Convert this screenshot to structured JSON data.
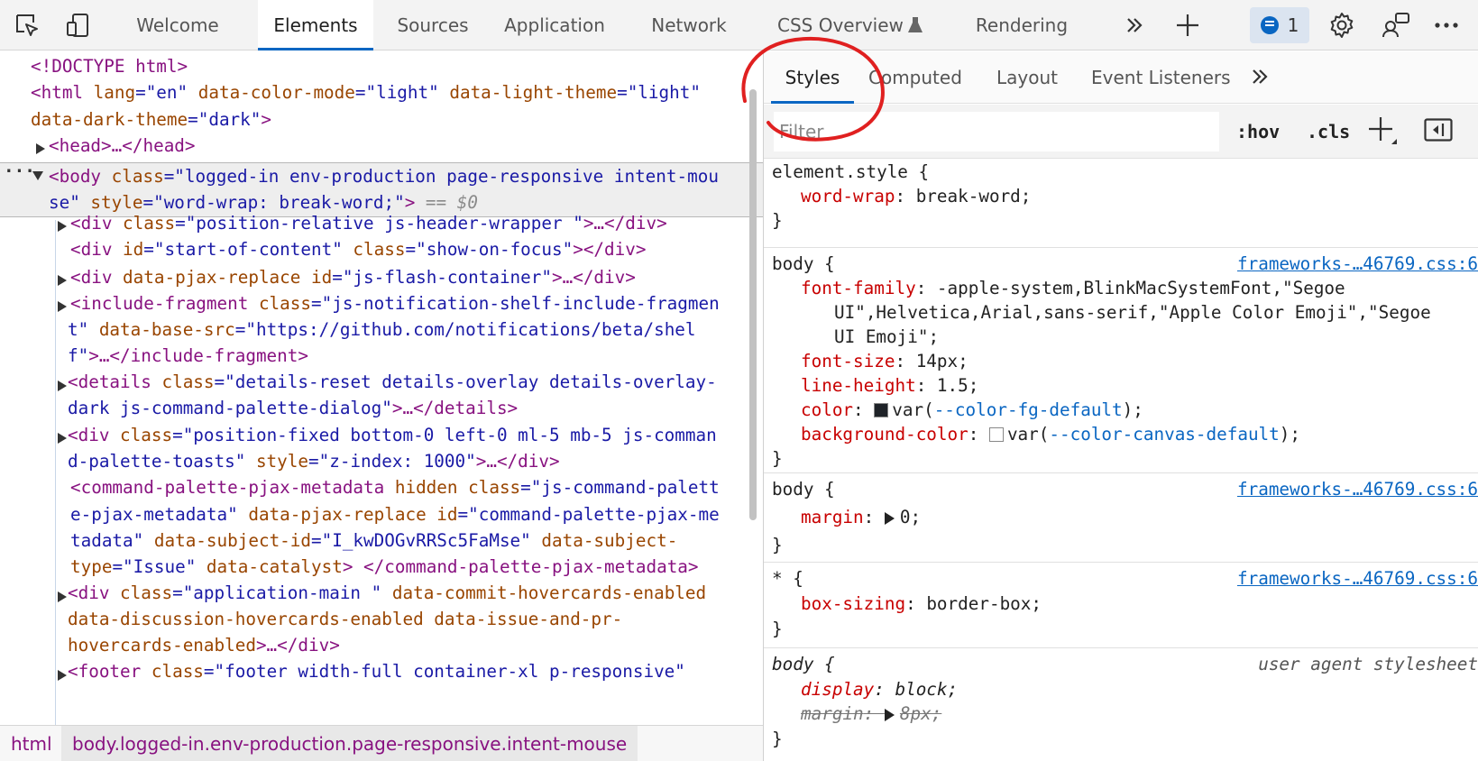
{
  "top_tabs": [
    "Welcome",
    "Elements",
    "Sources",
    "Application",
    "Network",
    "CSS Overview",
    "Rendering"
  ],
  "active_top_tab": "Elements",
  "issues_count": "1",
  "dom": {
    "l1": "<!DOCTYPE html>",
    "l2_tag": "<html",
    "l2_a1": " lang",
    "l2_v1": "=\"en\"",
    "l2_a2": " data-color-mode",
    "l2_v2": "=\"light\"",
    "l2_a3": " data-light-theme",
    "l2_v3": "=\"light\"",
    "l3_a": "data-dark-theme",
    "l3_v": "=\"dark\"",
    "l3_close": ">",
    "l4": "<head>…</head>",
    "l5_tag": "<body",
    "l5_a": " class",
    "l5_v": "=\"logged-in env-production page-responsive intent-mou",
    "l6_v": "se\"",
    "l6_a": " style",
    "l6_v2": "=\"word-wrap: break-word;\"",
    "l6_close": ">",
    "l6_eq": " == $0",
    "l7_tag": "<div",
    "l7_a": " class",
    "l7_v": "=\"position-relative js-header-wrapper \"",
    "l7_rest": ">…</div>",
    "l8_tag": "<div",
    "l8_a1": " id",
    "l8_v1": "=\"start-of-content\"",
    "l8_a2": " class",
    "l8_v2": "=\"show-on-focus\"",
    "l8_rest": "></div>",
    "l9_tag": "<div",
    "l9_a1": " data-pjax-replace",
    "l9_a2": " id",
    "l9_v2": "=\"js-flash-container\"",
    "l9_rest": ">…</div>",
    "l10_tag": "<include-fragment",
    "l10_a": " class",
    "l10_v": "=\"js-notification-shelf-include-fragmen",
    "l11_v": "t\"",
    "l11_a": " data-base-src",
    "l11_v2": "=\"https://github.com/notifications/beta/shel",
    "l12_v": "f\"",
    "l12_rest": ">…</include-fragment>",
    "l13_tag": "<details",
    "l13_a": " class",
    "l13_v": "=\"details-reset details-overlay details-overlay-",
    "l14_v": "dark js-command-palette-dialog\"",
    "l14_rest": ">…</details>",
    "l15_tag": "<div",
    "l15_a": " class",
    "l15_v": "=\"position-fixed bottom-0 left-0 ml-5 mb-5 js-comman",
    "l16_v": "d-palette-toasts\"",
    "l16_a": " style",
    "l16_v2": "=\"z-index: 1000\"",
    "l16_rest": ">…</div>",
    "l17_tag": "<command-palette-pjax-metadata",
    "l17_a1": " hidden",
    "l17_a2": " class",
    "l17_v2": "=\"js-command-palett",
    "l18_v": "e-pjax-metadata\"",
    "l18_a1": " data-pjax-replace",
    "l18_a2": " id",
    "l18_v2": "=\"command-palette-pjax-me",
    "l19_v": "tadata\"",
    "l19_a": " data-subject-id",
    "l19_v2": "=\"I_kwDOGvRRSc5FaMse\"",
    "l19_a2": " data-subject-",
    "l20_a": "type",
    "l20_v": "=\"Issue\"",
    "l20_a2": " data-catalyst",
    "l20_rest": "> </command-palette-pjax-metadata>",
    "l21_tag": "<div",
    "l21_a": " class",
    "l21_v": "=\"application-main \"",
    "l21_a2": " data-commit-hovercards-enabled",
    "l22_a": "data-discussion-hovercards-enabled data-issue-and-pr-",
    "l23_a": "hovercards-enabled",
    "l23_rest": ">…</div>",
    "l24_tag": "<footer",
    "l24_a": " class",
    "l24_v": "=\"footer width-full container-xl p-responsive\""
  },
  "breadcrumbs": [
    "html",
    "body.logged-in.env-production.page-responsive.intent-mouse"
  ],
  "styles_tabs": [
    "Styles",
    "Computed",
    "Layout",
    "Event Listeners"
  ],
  "active_styles_tab": "Styles",
  "filter_placeholder": "Filter",
  "filter_buttons": {
    "hov": ":hov",
    "cls": ".cls",
    "plus": "+"
  },
  "rules": {
    "r1_sel": "element.style {",
    "r1_p1": "word-wrap",
    "r1_v1": "break-word;",
    "close": "}",
    "r2_sel": "body {",
    "r2_src": "frameworks-…46769.css:6",
    "r2_p1": "font-family",
    "r2_v1a": "-apple-system,BlinkMacSystemFont,\"Segoe",
    "r2_v1b": "UI\",Helvetica,Arial,sans-serif,\"Apple Color Emoji\",\"Segoe",
    "r2_v1c": "UI Emoji\";",
    "r2_p2": "font-size",
    "r2_v2": "14px;",
    "r2_p3": "line-height",
    "r2_v3": "1.5;",
    "r2_p4": "color",
    "r2_v4_fn": "var(",
    "r2_v4_var": "--color-fg-default",
    "r2_v4_end": ");",
    "r2_p5": "background-color",
    "r2_v5_fn": "var(",
    "r2_v5_var": "--color-canvas-default",
    "r2_v5_end": ");",
    "r3_sel": "body {",
    "r3_src": "frameworks-…46769.css:6",
    "r3_p1": "margin",
    "r3_v1": "0;",
    "r4_sel": "* {",
    "r4_src": "frameworks-…46769.css:6",
    "r4_p1": "box-sizing",
    "r4_v1": "border-box;",
    "r5_sel": "body {",
    "r5_src": "user agent stylesheet",
    "r5_p1": "display",
    "r5_v1": "block;",
    "r5_p2": "margin",
    "r5_v2": "8px;"
  },
  "colors": {
    "accent": "#0a66c2",
    "annotation": "#e02020",
    "fg_default_swatch": "#1f2328",
    "canvas_default_swatch": "#ffffff"
  }
}
